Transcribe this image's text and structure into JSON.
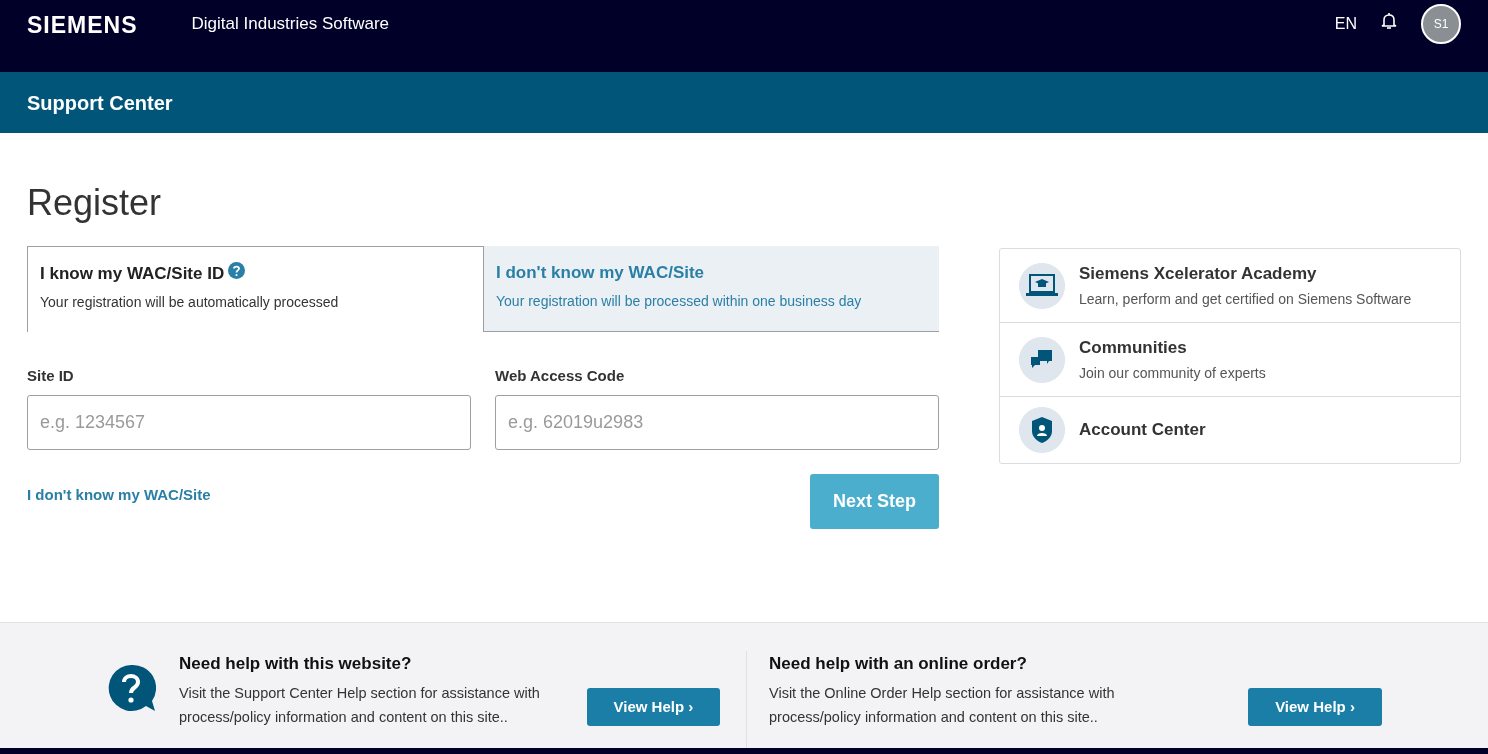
{
  "header": {
    "logo": "SIEMENS",
    "product": "Digital Industries Software",
    "language": "EN",
    "avatar": "S1"
  },
  "subheader": {
    "title": "Support Center"
  },
  "page_title": "Register",
  "tabs": [
    {
      "title": "I know my WAC/Site ID",
      "subtitle": "Your registration will be automatically processed",
      "selected": true,
      "help": true
    },
    {
      "title": "I don't know my WAC/Site",
      "subtitle": "Your registration will be processed within one business day",
      "selected": false,
      "help": false
    }
  ],
  "fields": [
    {
      "label": "Site ID",
      "placeholder": "e.g. 1234567"
    },
    {
      "label": "Web Access Code",
      "placeholder": "e.g. 62019u2983"
    }
  ],
  "link": "I don't know my WAC/Site",
  "next_button": {
    "label": "Next Step",
    "disabled": true
  },
  "side_links": [
    {
      "kind": "academy",
      "title": "Siemens Xcelerator Academy",
      "subtitle": "Learn, perform and get certified on Siemens Software"
    },
    {
      "kind": "communities",
      "title": "Communities",
      "subtitle": "Join our community of experts"
    },
    {
      "kind": "account",
      "title": "Account Center"
    }
  ],
  "help": [
    {
      "title": "Need help with this website?",
      "text": "Visit the Support Center Help section for assistance with process/policy information and content on this site..",
      "button": "View Help ›",
      "icon": true
    },
    {
      "title": "Need help with an online order?",
      "text": "Visit the Online Order Help section for assistance with process/policy information and content on this site..",
      "button": "View Help ›",
      "icon": false
    }
  ]
}
